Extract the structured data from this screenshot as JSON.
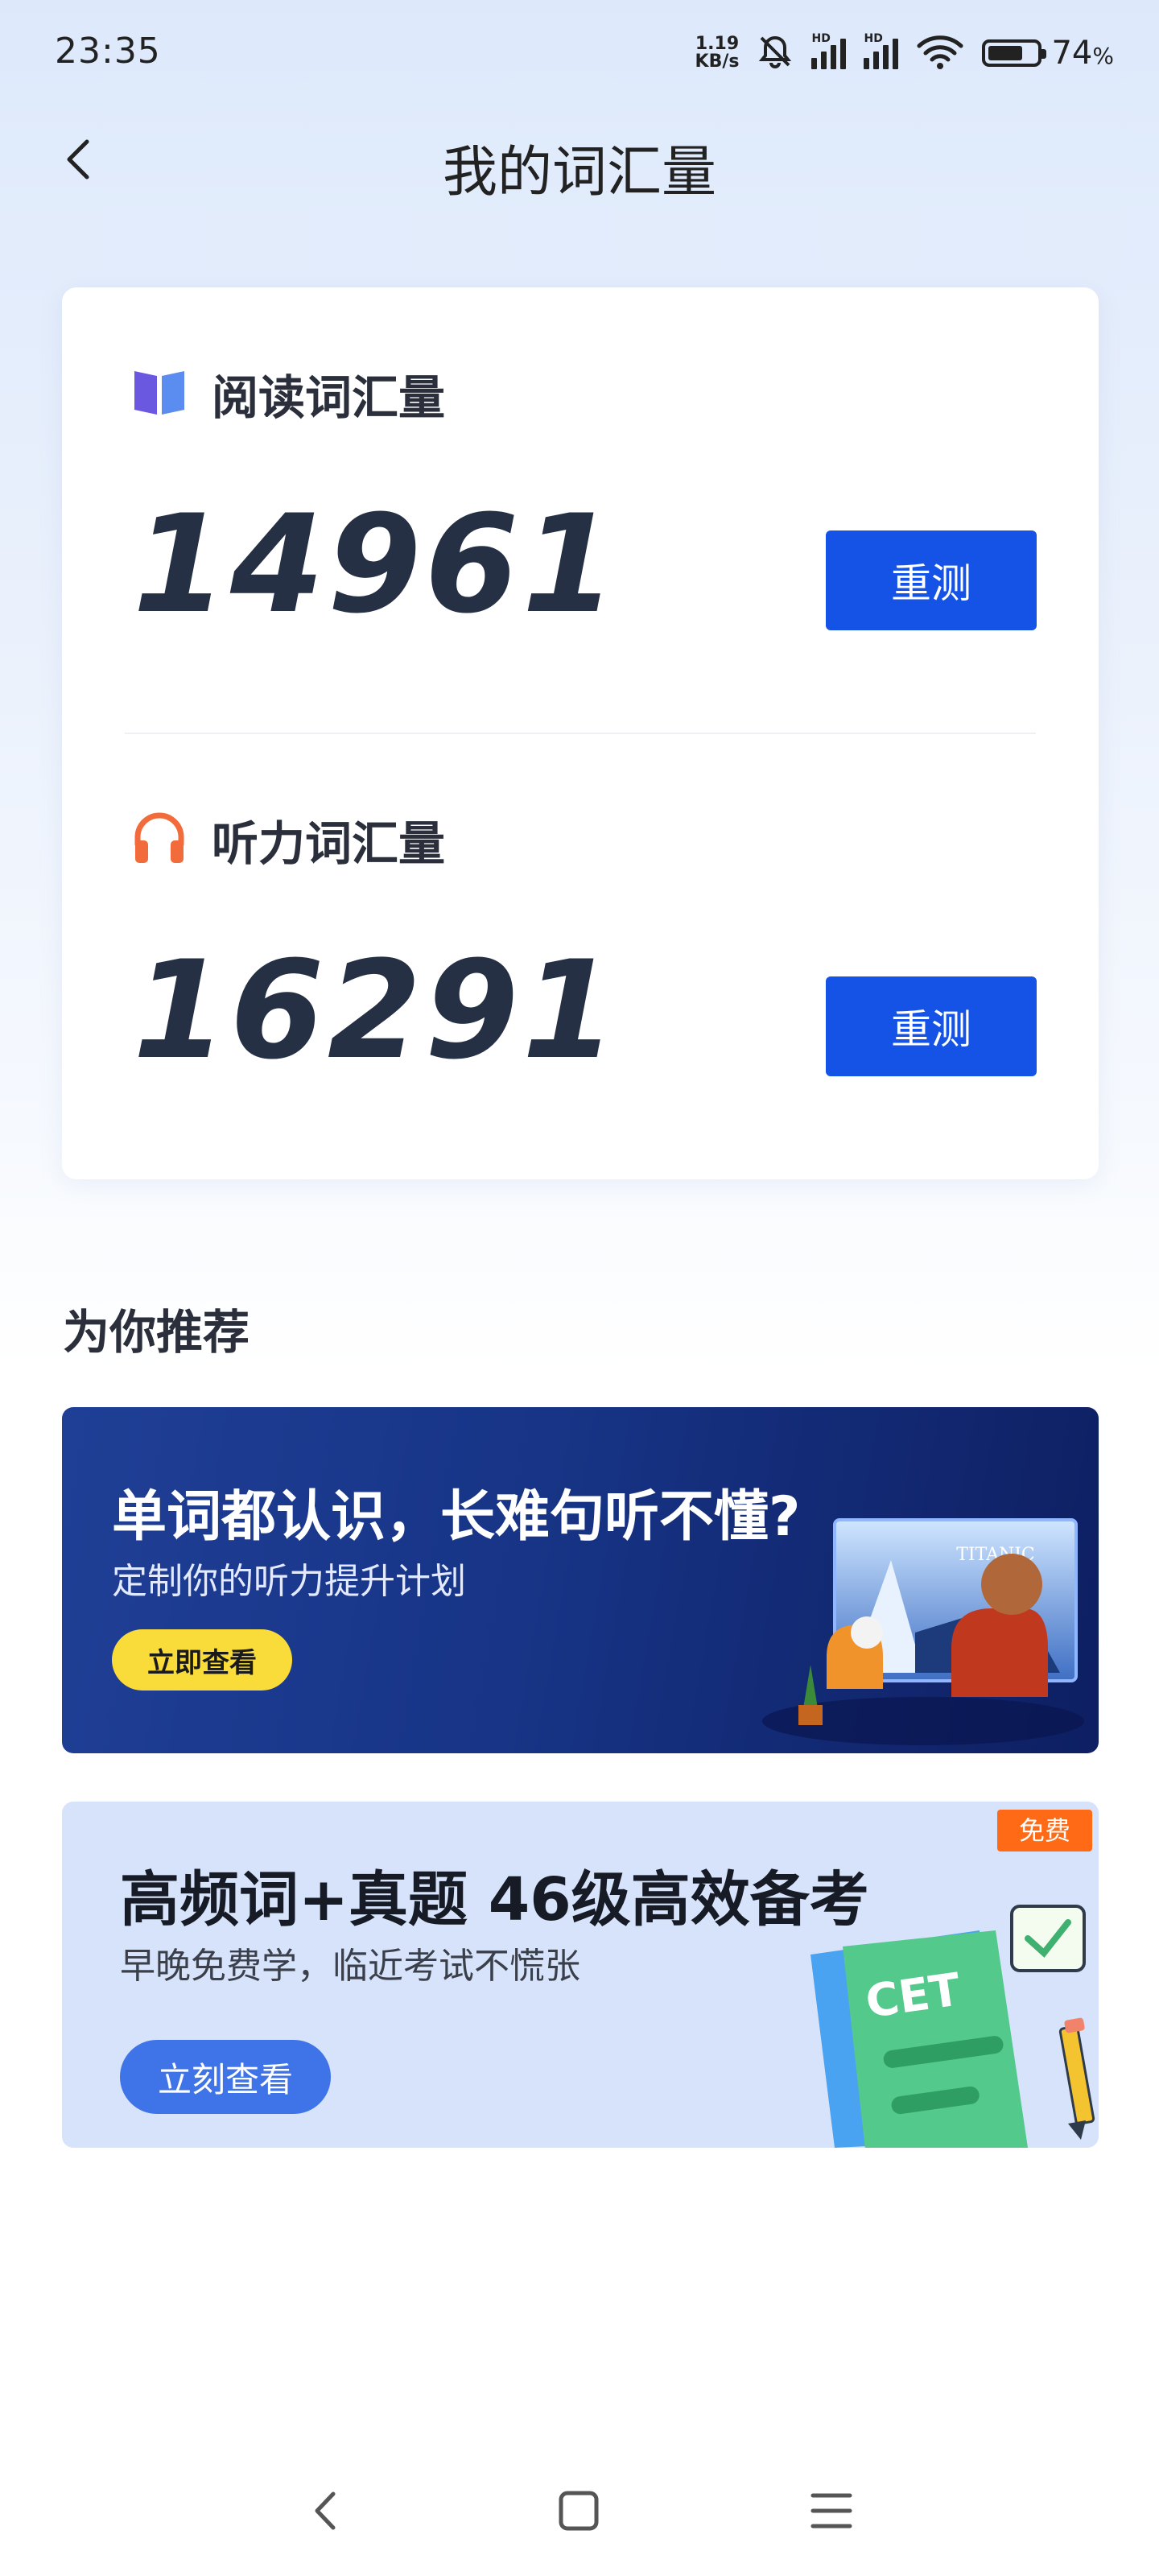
{
  "status": {
    "time": "23:35",
    "net_speed_value": "1.19",
    "net_speed_unit": "KB/s",
    "hd1": "HD",
    "hd2": "HD",
    "battery": "74",
    "battery_unit": "%"
  },
  "header": {
    "title": "我的词汇量"
  },
  "vocab": {
    "reading": {
      "label": "阅读词汇量",
      "value": "14961",
      "button": "重测"
    },
    "listening": {
      "label": "听力词汇量",
      "value": "16291",
      "button": "重测"
    }
  },
  "recommend": {
    "title": "为你推荐",
    "banner1": {
      "title": "单词都认识，长难句听不懂?",
      "subtitle": "定制你的听力提升计划",
      "button": "立即查看",
      "poster_text": "TITANIC"
    },
    "banner2": {
      "badge": "免费",
      "title": "高频词+真题 46级高效备考",
      "subtitle": "早晚免费学，临近考试不慌张",
      "button": "立刻查看",
      "doc_text": "CET"
    }
  },
  "colors": {
    "accent": "#1552e6",
    "banner1_bg": "#173486",
    "banner1_button": "#f9dc3a",
    "banner2_bg": "#d6e3fb",
    "banner2_button": "#3f73e8",
    "badge": "#ff6a16",
    "book_icon": "#6a58e0",
    "headphone_icon": "#f26b3a"
  },
  "icons": [
    "back-arrow-icon",
    "book-icon",
    "headphone-icon",
    "mute-bell-icon",
    "signal-icon",
    "wifi-icon",
    "battery-icon",
    "nav-back-icon",
    "nav-home-icon",
    "nav-menu-icon"
  ]
}
